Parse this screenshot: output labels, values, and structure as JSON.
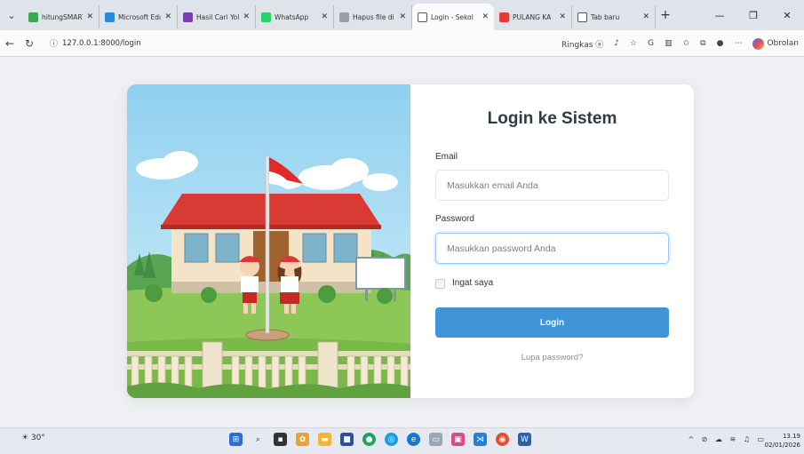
{
  "browser": {
    "tabs": [
      {
        "label": "hitungSMART",
        "color": "#3aa757"
      },
      {
        "label": "Microsoft Edu",
        "color": "#2b88d8"
      },
      {
        "label": "Hasil Cari Yol",
        "color": "#7b3fb5"
      },
      {
        "label": "WhatsApp",
        "color": "#25d366"
      },
      {
        "label": "Hapus file di",
        "color": "#9aa0a6"
      },
      {
        "label": "Login - Sekol",
        "color": "#ffffff",
        "active": true
      },
      {
        "label": "PULANG KA",
        "color": "#e53935"
      },
      {
        "label": "Tab baru",
        "color": "#ffffff"
      }
    ],
    "new_tab": "+",
    "url": "127.0.0.1:8000/login",
    "ringkas": "Ringkas",
    "obrolan": "Obrolan"
  },
  "login": {
    "title": "Login ke Sistem",
    "email_label": "Email",
    "email_placeholder": "Masukkan email Anda",
    "password_label": "Password",
    "password_placeholder": "Masukkan password Anda",
    "remember_label": "Ingat saya",
    "login_button": "Login",
    "forgot_link": "Lupa password?"
  },
  "taskbar": {
    "weather": "30°",
    "time": "13.19",
    "date": "02/01/2026"
  },
  "colors": {
    "accent": "#3f95d8",
    "roof": "#d93a34",
    "sky": "#aee0f5",
    "grass": "#7cc04f"
  }
}
